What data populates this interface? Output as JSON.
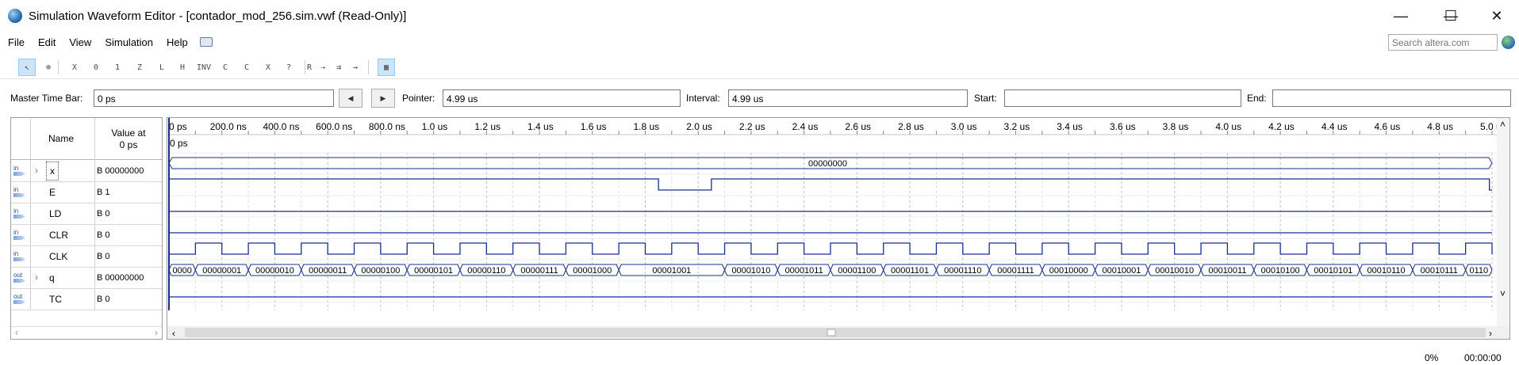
{
  "window": {
    "title": "Simulation Waveform Editor - [contador_mod_256.sim.vwf (Read-Only)]",
    "minimize_glyph": "—",
    "maximize_glyph": "☐",
    "close_glyph": "✕"
  },
  "menu": [
    "File",
    "Edit",
    "View",
    "Simulation",
    "Help"
  ],
  "search": {
    "placeholder": "Search altera.com"
  },
  "toolbar": {
    "tools": [
      "select-pointer",
      "zoom",
      "forcing-unknown",
      "forcing-low",
      "forcing-high",
      "high-impedance",
      "weak-low",
      "weak-high",
      "invert",
      "count-value",
      "clock",
      "arbitrary-value",
      "random-value",
      "snap-to-grid",
      "overwrite",
      "arrange",
      "show-grid",
      "grid-table"
    ],
    "tool_glyphs": [
      "↖",
      "⊕",
      "X",
      "0",
      "1",
      "Z",
      "L",
      "H",
      "INV",
      "C",
      "C",
      "X",
      "?",
      "R",
      "⇢",
      "⇉",
      "⇝",
      "▦",
      "▤"
    ]
  },
  "timebar": {
    "master_time_bar_label": "Master Time Bar:",
    "master_time_bar_value": "0 ps",
    "prev_glyph": "◀",
    "next_glyph": "▶",
    "pointer_label": "Pointer:",
    "pointer_value": "4.99 us",
    "interval_label": "Interval:",
    "interval_value": "4.99 us",
    "start_label": "Start:",
    "start_value": "",
    "end_label": "End:",
    "end_value": ""
  },
  "signal_table": {
    "header_name": "Name",
    "header_value_line1": "Value at",
    "header_value_line2": "0 ps",
    "rows": [
      {
        "dir": "in",
        "expandable": true,
        "name": "x",
        "value": "B 00000000"
      },
      {
        "dir": "in",
        "expandable": false,
        "name": "E",
        "value": "B 1"
      },
      {
        "dir": "in",
        "expandable": false,
        "name": "LD",
        "value": "B 0"
      },
      {
        "dir": "in",
        "expandable": false,
        "name": "CLR",
        "value": "B 0"
      },
      {
        "dir": "in",
        "expandable": false,
        "name": "CLK",
        "value": "B 0"
      },
      {
        "dir": "out",
        "expandable": true,
        "name": "q",
        "value": "B 00000000"
      },
      {
        "dir": "out",
        "expandable": false,
        "name": "TC",
        "value": "B 0"
      }
    ]
  },
  "waveform": {
    "time_ticks": [
      "0 ps",
      "200.0 ns",
      "400.0 ns",
      "600.0 ns",
      "800.0 ns",
      "1.0 us",
      "1.2 us",
      "1.4 us",
      "1.6 us",
      "1.8 us",
      "2.0 us",
      "2.2 us",
      "2.4 us",
      "2.6 us",
      "2.8 us",
      "3.0 us",
      "3.2 us",
      "3.4 us",
      "3.6 us",
      "3.8 us",
      "4.0 us",
      "4.2 us",
      "4.4 us",
      "4.6 us",
      "4.8 us",
      "5.0 us"
    ],
    "cursor_label": "0 ps",
    "x_bus_value": "00000000",
    "q_bus_values": [
      "0000",
      "00000001",
      "00000010",
      "00000011",
      "00000100",
      "00000101",
      "00000110",
      "00000111",
      "00001000",
      "00001001",
      "00001010",
      "00001011",
      "00001100",
      "00001101",
      "00001110",
      "00001111",
      "00010000",
      "00010001",
      "00010010",
      "00010011",
      "00010100",
      "00010101",
      "00010110",
      "00010111",
      "0110"
    ]
  },
  "status": {
    "progress": "0%",
    "elapsed": "00:00:00"
  }
}
